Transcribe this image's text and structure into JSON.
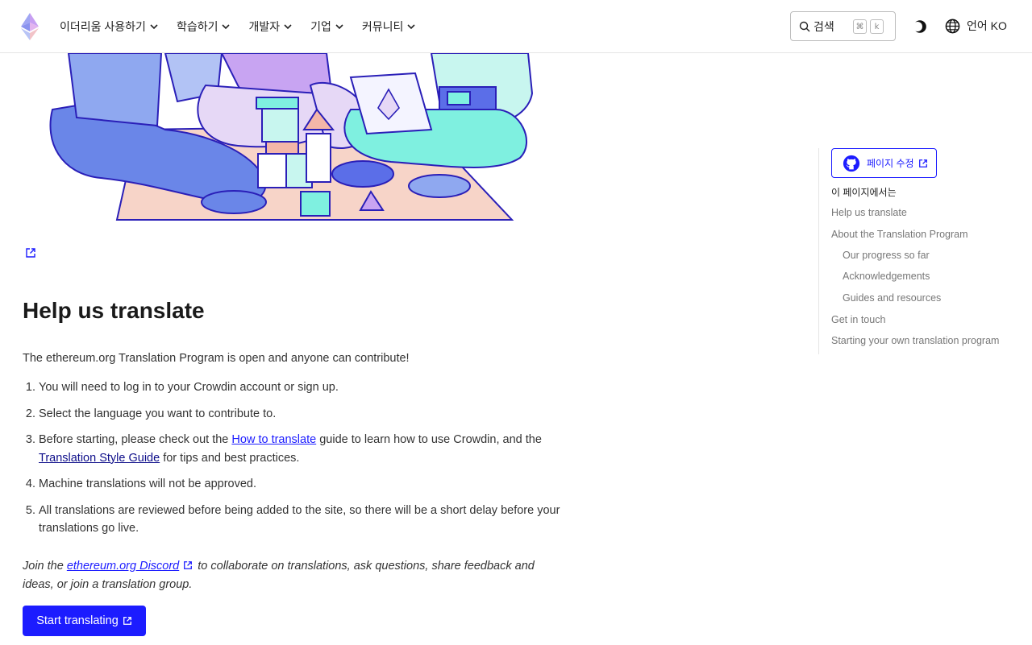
{
  "header": {
    "nav": [
      {
        "label": "이더리움 사용하기"
      },
      {
        "label": "학습하기"
      },
      {
        "label": "개발자"
      },
      {
        "label": "기업"
      },
      {
        "label": "커뮤니티"
      }
    ],
    "search_label": "검색",
    "search_kbd_1": "⌘",
    "search_kbd_2": "k",
    "lang_label": "언어 KO"
  },
  "main": {
    "title": "Help us translate",
    "intro": "The ethereum.org Translation Program is open and anyone can contribute!",
    "steps": {
      "s1": "You will need to log in to your Crowdin account or sign up.",
      "s2": "Select the language you want to contribute to.",
      "s3_pre": "Before starting, please check out the ",
      "s3_link1": "How to translate",
      "s3_mid": " guide to learn how to use Crowdin, and the ",
      "s3_link2": "Translation Style Guide",
      "s3_post": " for tips and best practices.",
      "s4": "Machine translations will not be approved.",
      "s5": "All translations are reviewed before being added to the site, so there will be a short delay before your translations go live."
    },
    "join_pre": "Join the ",
    "join_link": "ethereum.org Discord",
    "join_post": " to collaborate on translations, ask questions, share feedback and ideas, or join a translation group.",
    "cta_label": "Start translating"
  },
  "toc": {
    "edit_label": "페이지 수정",
    "title": "이 페이지에서는",
    "items": [
      {
        "label": "Help us translate"
      },
      {
        "label": "About the Translation Program"
      },
      {
        "label": "Our progress so far"
      },
      {
        "label": "Acknowledgements"
      },
      {
        "label": "Guides and resources"
      },
      {
        "label": "Get in touch"
      },
      {
        "label": "Starting your own translation program"
      }
    ]
  },
  "colors": {
    "accent": "#1c1cff",
    "text": "#333333",
    "muted": "#777777"
  }
}
